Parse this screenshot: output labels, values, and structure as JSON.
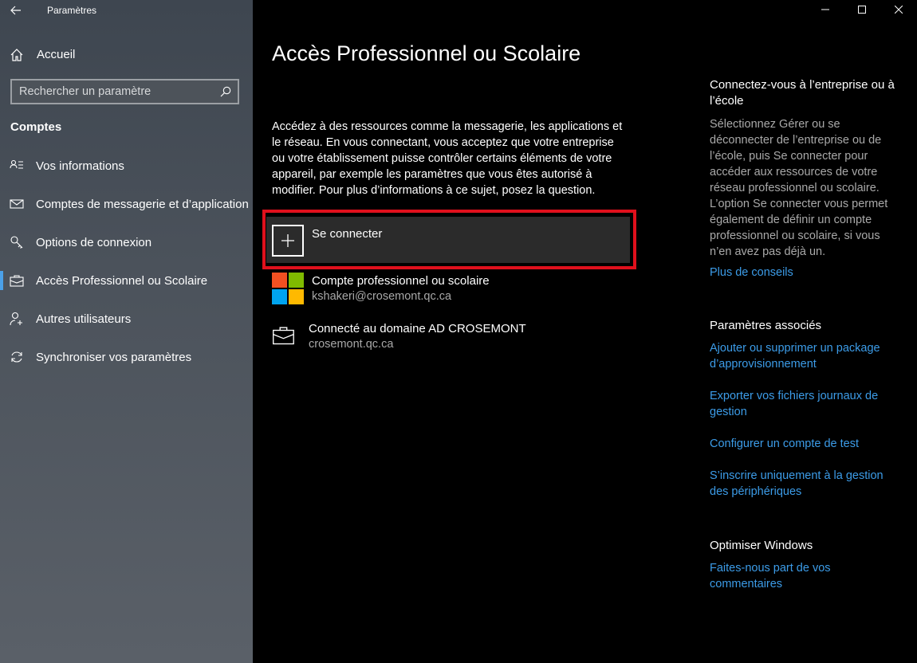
{
  "window": {
    "app_title": "Paramètres"
  },
  "sidebar": {
    "home_label": "Accueil",
    "search_placeholder": "Rechercher un paramètre",
    "section_title": "Comptes",
    "items": [
      {
        "label": "Vos informations",
        "icon": "person-list-icon"
      },
      {
        "label": "Comptes de messagerie et d’application",
        "icon": "mail-icon"
      },
      {
        "label": "Options de connexion",
        "icon": "key-icon"
      },
      {
        "label": "Accès Professionnel ou Scolaire",
        "icon": "briefcase-icon",
        "active": true
      },
      {
        "label": "Autres utilisateurs",
        "icon": "person-add-icon"
      },
      {
        "label": "Synchroniser vos paramètres",
        "icon": "sync-icon"
      }
    ]
  },
  "main": {
    "title": "Accès Professionnel ou Scolaire",
    "description": "Accédez à des ressources comme la messagerie, les applications et le réseau. En vous connectant, vous acceptez que votre entreprise ou votre établissement puisse contrôler certains éléments de votre appareil, par exemple les paramètres que vous êtes autorisé à modifier. Pour plus d’informations à ce sujet, posez la question.",
    "connect_label": "Se connecter",
    "accounts": [
      {
        "title": "Compte professionnel ou scolaire",
        "subtitle": "kshakeri@crosemont.qc.ca",
        "icon": "microsoft-logo-icon"
      },
      {
        "title": "Connecté au domaine AD CROSEMONT",
        "subtitle": "crosemont.qc.ca",
        "icon": "briefcase-icon"
      }
    ]
  },
  "right_panel": {
    "connect_heading": "Connectez-vous à l’entreprise ou à l’école",
    "connect_text": "Sélectionnez Gérer ou se déconnecter de l’entreprise ou de l’école, puis Se connecter pour accéder aux ressources de votre réseau professionnel ou scolaire. L’option Se connecter vous permet également de définir un compte professionnel ou scolaire, si vous n’en avez pas déjà un.",
    "tips_link": "Plus de conseils",
    "related_heading": "Paramètres associés",
    "related_links": [
      "Ajouter ou supprimer un package d’approvisionnement",
      "Exporter vos fichiers journaux de gestion",
      "Configurer un compte de test",
      "S’inscrire uniquement à la gestion des périphériques"
    ],
    "optimize_heading": "Optimiser Windows",
    "feedback_link": "Faites-nous part de vos commentaires"
  },
  "colors": {
    "accent": "#3c9ce8",
    "highlight": "#e0101c",
    "ms_red": "#f25022",
    "ms_green": "#7fba00",
    "ms_blue": "#00a4ef",
    "ms_yellow": "#ffb900"
  }
}
